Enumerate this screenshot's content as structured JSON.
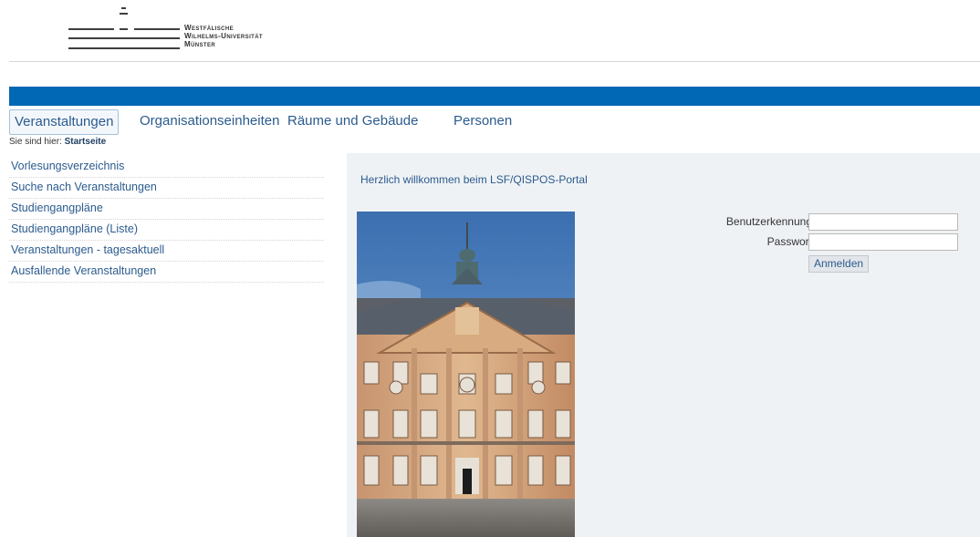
{
  "university": {
    "name_line1": "Westfälische",
    "name_line2": "Wilhelms-Universität",
    "name_line3": "Münster"
  },
  "nav": {
    "items": [
      {
        "label": "Veranstaltungen",
        "active": true
      },
      {
        "label": "Organisationseinheiten",
        "active": false
      },
      {
        "label": "Räume und Gebäude",
        "active": false
      },
      {
        "label": "Personen",
        "active": false
      }
    ]
  },
  "breadcrumb": {
    "prefix": "Sie sind hier:",
    "current": "Startseite"
  },
  "sidebar": {
    "items": [
      {
        "label": "Vorlesungsverzeichnis"
      },
      {
        "label": "Suche nach Veranstaltungen"
      },
      {
        "label": "Studiengangpläne"
      },
      {
        "label": "Studiengangpläne (Liste)"
      },
      {
        "label": "Veranstaltungen - tagesaktuell"
      },
      {
        "label": "Ausfallende Veranstaltungen"
      }
    ]
  },
  "main": {
    "welcome": "Herzlich willkommen beim LSF/QISPOS-Portal"
  },
  "login": {
    "username_label": "Benutzerkennung",
    "username_value": "",
    "password_label": "Passwort",
    "password_value": "",
    "submit_label": "Anmelden"
  },
  "colors": {
    "accent_bar": "#0068b4",
    "link": "#2b5b8e",
    "content_bg": "#eff2f5"
  }
}
